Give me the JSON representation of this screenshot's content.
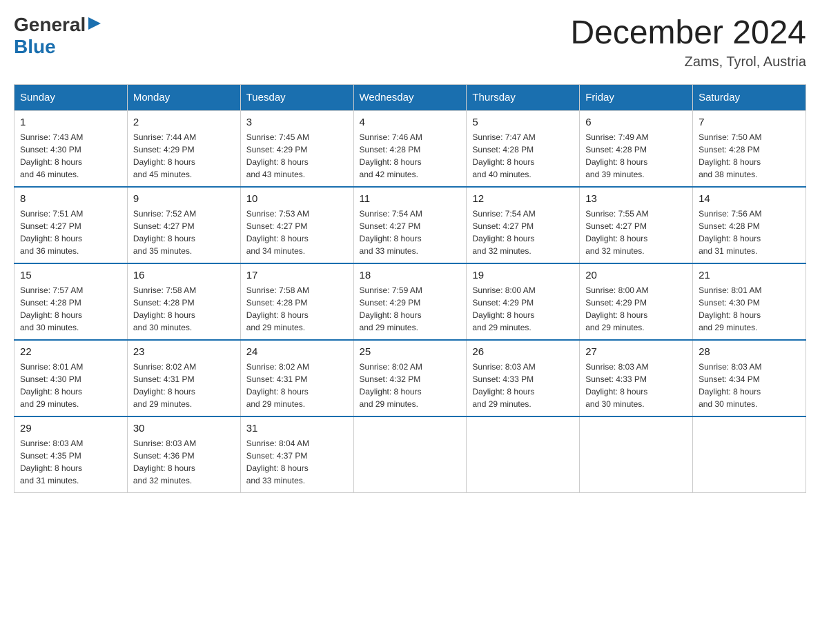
{
  "header": {
    "logo_general": "General",
    "logo_blue": "Blue",
    "month_title": "December 2024",
    "location": "Zams, Tyrol, Austria"
  },
  "days_of_week": [
    "Sunday",
    "Monday",
    "Tuesday",
    "Wednesday",
    "Thursday",
    "Friday",
    "Saturday"
  ],
  "weeks": [
    [
      {
        "day": "1",
        "sunrise": "7:43 AM",
        "sunset": "4:30 PM",
        "daylight": "8 hours and 46 minutes."
      },
      {
        "day": "2",
        "sunrise": "7:44 AM",
        "sunset": "4:29 PM",
        "daylight": "8 hours and 45 minutes."
      },
      {
        "day": "3",
        "sunrise": "7:45 AM",
        "sunset": "4:29 PM",
        "daylight": "8 hours and 43 minutes."
      },
      {
        "day": "4",
        "sunrise": "7:46 AM",
        "sunset": "4:28 PM",
        "daylight": "8 hours and 42 minutes."
      },
      {
        "day": "5",
        "sunrise": "7:47 AM",
        "sunset": "4:28 PM",
        "daylight": "8 hours and 40 minutes."
      },
      {
        "day": "6",
        "sunrise": "7:49 AM",
        "sunset": "4:28 PM",
        "daylight": "8 hours and 39 minutes."
      },
      {
        "day": "7",
        "sunrise": "7:50 AM",
        "sunset": "4:28 PM",
        "daylight": "8 hours and 38 minutes."
      }
    ],
    [
      {
        "day": "8",
        "sunrise": "7:51 AM",
        "sunset": "4:27 PM",
        "daylight": "8 hours and 36 minutes."
      },
      {
        "day": "9",
        "sunrise": "7:52 AM",
        "sunset": "4:27 PM",
        "daylight": "8 hours and 35 minutes."
      },
      {
        "day": "10",
        "sunrise": "7:53 AM",
        "sunset": "4:27 PM",
        "daylight": "8 hours and 34 minutes."
      },
      {
        "day": "11",
        "sunrise": "7:54 AM",
        "sunset": "4:27 PM",
        "daylight": "8 hours and 33 minutes."
      },
      {
        "day": "12",
        "sunrise": "7:54 AM",
        "sunset": "4:27 PM",
        "daylight": "8 hours and 32 minutes."
      },
      {
        "day": "13",
        "sunrise": "7:55 AM",
        "sunset": "4:27 PM",
        "daylight": "8 hours and 32 minutes."
      },
      {
        "day": "14",
        "sunrise": "7:56 AM",
        "sunset": "4:28 PM",
        "daylight": "8 hours and 31 minutes."
      }
    ],
    [
      {
        "day": "15",
        "sunrise": "7:57 AM",
        "sunset": "4:28 PM",
        "daylight": "8 hours and 30 minutes."
      },
      {
        "day": "16",
        "sunrise": "7:58 AM",
        "sunset": "4:28 PM",
        "daylight": "8 hours and 30 minutes."
      },
      {
        "day": "17",
        "sunrise": "7:58 AM",
        "sunset": "4:28 PM",
        "daylight": "8 hours and 29 minutes."
      },
      {
        "day": "18",
        "sunrise": "7:59 AM",
        "sunset": "4:29 PM",
        "daylight": "8 hours and 29 minutes."
      },
      {
        "day": "19",
        "sunrise": "8:00 AM",
        "sunset": "4:29 PM",
        "daylight": "8 hours and 29 minutes."
      },
      {
        "day": "20",
        "sunrise": "8:00 AM",
        "sunset": "4:29 PM",
        "daylight": "8 hours and 29 minutes."
      },
      {
        "day": "21",
        "sunrise": "8:01 AM",
        "sunset": "4:30 PM",
        "daylight": "8 hours and 29 minutes."
      }
    ],
    [
      {
        "day": "22",
        "sunrise": "8:01 AM",
        "sunset": "4:30 PM",
        "daylight": "8 hours and 29 minutes."
      },
      {
        "day": "23",
        "sunrise": "8:02 AM",
        "sunset": "4:31 PM",
        "daylight": "8 hours and 29 minutes."
      },
      {
        "day": "24",
        "sunrise": "8:02 AM",
        "sunset": "4:31 PM",
        "daylight": "8 hours and 29 minutes."
      },
      {
        "day": "25",
        "sunrise": "8:02 AM",
        "sunset": "4:32 PM",
        "daylight": "8 hours and 29 minutes."
      },
      {
        "day": "26",
        "sunrise": "8:03 AM",
        "sunset": "4:33 PM",
        "daylight": "8 hours and 29 minutes."
      },
      {
        "day": "27",
        "sunrise": "8:03 AM",
        "sunset": "4:33 PM",
        "daylight": "8 hours and 30 minutes."
      },
      {
        "day": "28",
        "sunrise": "8:03 AM",
        "sunset": "4:34 PM",
        "daylight": "8 hours and 30 minutes."
      }
    ],
    [
      {
        "day": "29",
        "sunrise": "8:03 AM",
        "sunset": "4:35 PM",
        "daylight": "8 hours and 31 minutes."
      },
      {
        "day": "30",
        "sunrise": "8:03 AM",
        "sunset": "4:36 PM",
        "daylight": "8 hours and 32 minutes."
      },
      {
        "day": "31",
        "sunrise": "8:04 AM",
        "sunset": "4:37 PM",
        "daylight": "8 hours and 33 minutes."
      },
      null,
      null,
      null,
      null
    ]
  ],
  "labels": {
    "sunrise": "Sunrise:",
    "sunset": "Sunset:",
    "daylight": "Daylight:"
  }
}
